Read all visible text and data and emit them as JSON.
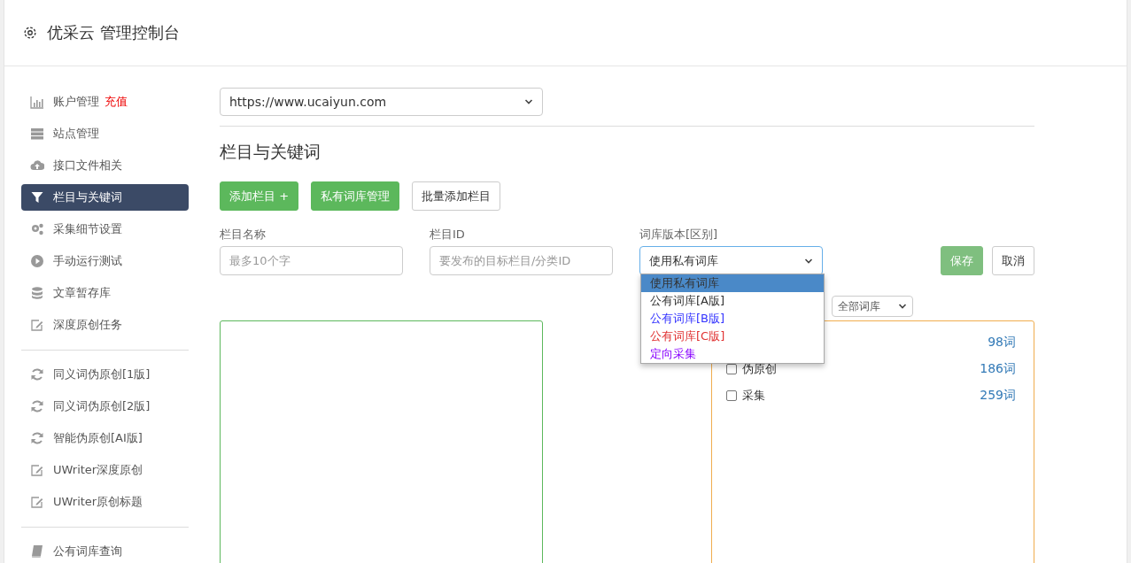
{
  "header": {
    "title": "优采云 管理控制台"
  },
  "sidebar": {
    "groups": [
      {
        "items": [
          {
            "kind": "chart",
            "label": "账户管理",
            "badge": "充值",
            "selected": false
          },
          {
            "kind": "server",
            "label": "站点管理",
            "selected": false
          },
          {
            "kind": "cloud",
            "label": "接口文件相关",
            "selected": false
          },
          {
            "kind": "filter",
            "label": "栏目与关键词",
            "selected": true
          },
          {
            "kind": "gears",
            "label": "采集细节设置",
            "selected": false
          },
          {
            "kind": "play",
            "label": "手动运行测试",
            "selected": false
          },
          {
            "kind": "database",
            "label": "文章暂存库",
            "selected": false
          },
          {
            "kind": "edit",
            "label": "深度原创任务",
            "selected": false
          }
        ]
      },
      {
        "items": [
          {
            "kind": "refresh",
            "label": "同义词伪原创[1版]",
            "selected": false
          },
          {
            "kind": "refresh",
            "label": "同义词伪原创[2版]",
            "selected": false
          },
          {
            "kind": "refresh",
            "label": "智能伪原创[AI版]",
            "selected": false
          },
          {
            "kind": "edit",
            "label": "UWriter深度原创",
            "selected": false
          },
          {
            "kind": "edit",
            "label": "UWriter原创标题",
            "selected": false
          }
        ]
      },
      {
        "items": [
          {
            "kind": "book",
            "label": "公有词库查询",
            "selected": false
          }
        ]
      }
    ]
  },
  "site_select": {
    "value": "https://www.ucaiyun.com"
  },
  "section_title": "栏目与关键词",
  "actions": [
    {
      "label": "添加栏目 +",
      "kind": "primary"
    },
    {
      "label": "私有词库管理",
      "kind": "primary"
    },
    {
      "label": "批量添加栏目",
      "kind": "default"
    }
  ],
  "form": {
    "fields": [
      {
        "label": "栏目名称",
        "kind": "input",
        "placeholder": "最多10个字"
      },
      {
        "label": "栏目ID",
        "kind": "input",
        "placeholder": "要发布的目标栏目/分类ID"
      },
      {
        "label": "词库版本[区别]",
        "kind": "select",
        "value": "使用私有词库"
      }
    ],
    "save": "保存",
    "cancel": "取消",
    "dropdown": [
      {
        "label": "使用私有词库",
        "selected": true
      },
      {
        "label": "公有词库[A版]",
        "selected": false,
        "color": "#333333"
      },
      {
        "label": "公有词库[B版]",
        "selected": false,
        "color": "#3333ff"
      },
      {
        "label": "公有词库[C版]",
        "selected": false,
        "color": "#e03030"
      },
      {
        "label": "定向采集",
        "selected": false,
        "color": "#8800ff"
      }
    ]
  },
  "library_filter": {
    "value": "全部词库"
  },
  "library_list": [
    {
      "count": "98词"
    },
    {
      "label": "伪原创",
      "count": "186词",
      "checked": false
    },
    {
      "label": "采集",
      "count": "259词",
      "checked": false
    }
  ]
}
